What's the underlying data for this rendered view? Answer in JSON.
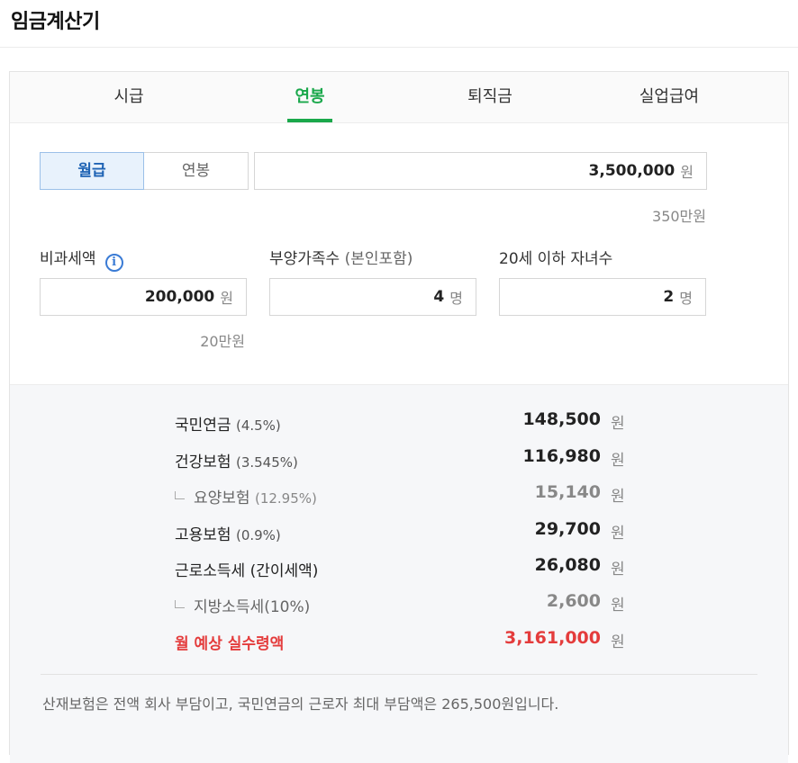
{
  "header": {
    "title": "임금계산기"
  },
  "tabs": [
    {
      "label": "시급",
      "active": false
    },
    {
      "label": "연봉",
      "active": true
    },
    {
      "label": "퇴직금",
      "active": false
    },
    {
      "label": "실업급여",
      "active": false
    }
  ],
  "pay_type": {
    "monthly_label": "월급",
    "annual_label": "연봉",
    "selected": "월급"
  },
  "salary": {
    "value": "3,500,000",
    "unit": "원",
    "helper": "350만원"
  },
  "nontax": {
    "label": "비과세액",
    "value": "200,000",
    "unit": "원",
    "helper": "20만원"
  },
  "dependents": {
    "label": "부양가족수",
    "label_sub": "(본인포함)",
    "value": "4",
    "unit": "명"
  },
  "children": {
    "label": "20세 이하 자녀수",
    "value": "2",
    "unit": "명"
  },
  "results": {
    "unit": "원",
    "rows": [
      {
        "label": "국민연금",
        "pct": "(4.5%)",
        "value": "148,500"
      },
      {
        "label": "건강보험",
        "pct": "(3.545%)",
        "value": "116,980"
      },
      {
        "label": "요양보험",
        "pct": "(12.95%)",
        "value": "15,140"
      },
      {
        "label": "고용보험",
        "pct": "(0.9%)",
        "value": "29,700"
      },
      {
        "label": "근로소득세 (간이세액)",
        "pct": "",
        "value": "26,080"
      },
      {
        "label": "지방소득세(10%)",
        "pct": "",
        "value": "2,600"
      }
    ],
    "total": {
      "label": "월 예상 실수령액",
      "value": "3,161,000"
    }
  },
  "footnote": "산재보험은 전액 회사 부담이고, 국민연금의 근로자 최대 부담액은 265,500원입니다.",
  "colors": {
    "accent": "#1aa84b",
    "selected_blue": "#1e63b4",
    "total_red": "#e43c3c"
  }
}
